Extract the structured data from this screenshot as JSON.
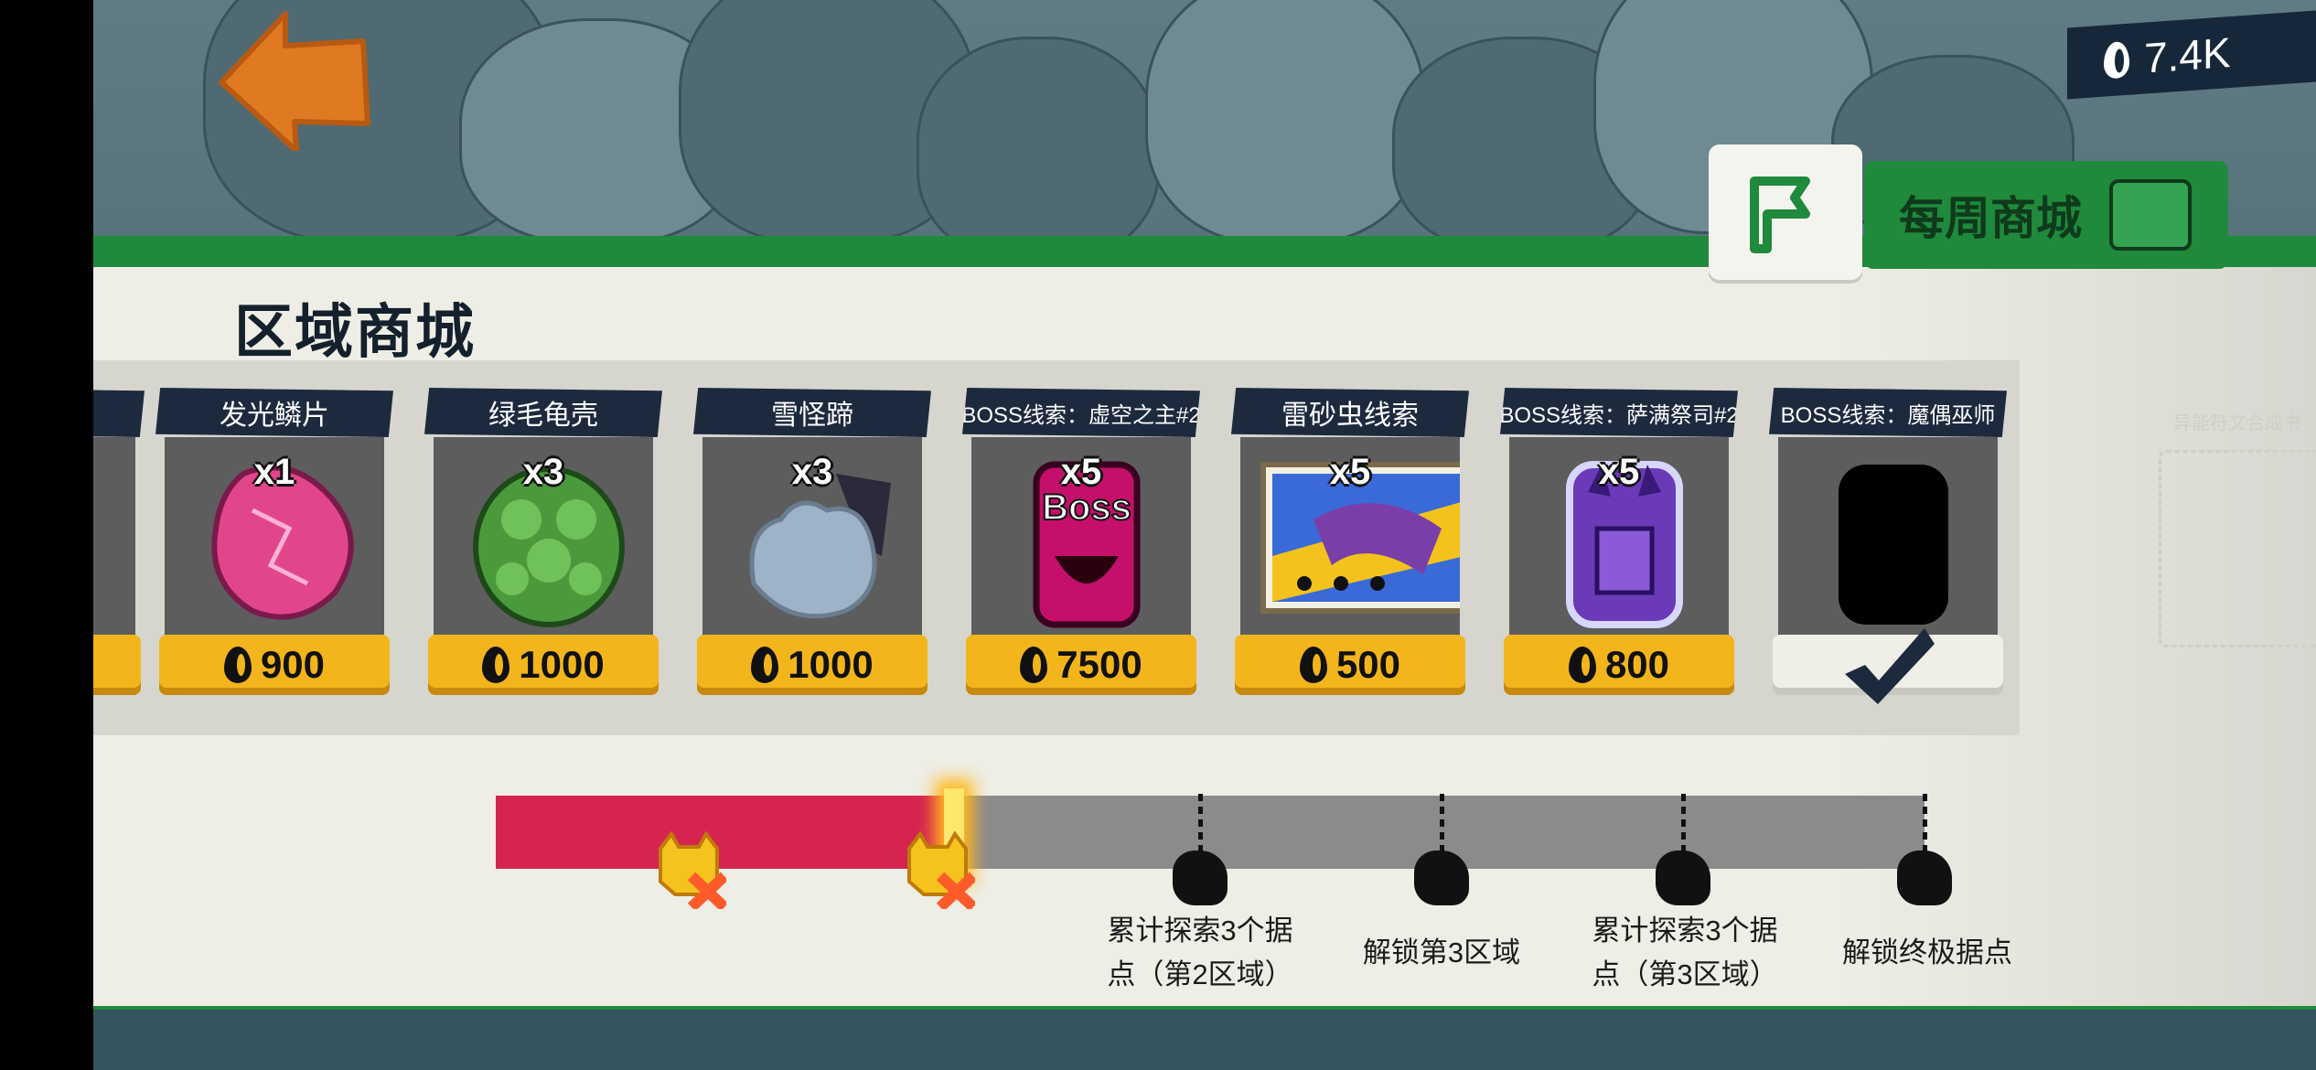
{
  "header": {
    "currency_amount": "7.4K",
    "tabs": [
      {
        "label": "",
        "icon": "flag-icon"
      },
      {
        "label": "每周商城",
        "icon": "chest-monster-icon"
      }
    ]
  },
  "shop": {
    "title": "区域商城",
    "items": [
      {
        "name": "发光鳞片",
        "qty": "x1",
        "price": "900",
        "icon": "glowing-scale-icon",
        "color": "#e2468a"
      },
      {
        "name": "绿毛龟壳",
        "qty": "x3",
        "price": "1000",
        "icon": "turtle-shell-icon",
        "color": "#4a9a3c"
      },
      {
        "name": "雪怪蹄",
        "qty": "x3",
        "price": "1000",
        "icon": "yeti-hoof-icon",
        "color": "#9fb3c8"
      },
      {
        "name": "BOSS线索：虚空之主#2",
        "qty": "x5",
        "price": "7500",
        "icon": "boss-card-icon",
        "color": "#c4106a",
        "boss_text": "Boss"
      },
      {
        "name": "雷砂虫线索",
        "qty": "x5",
        "price": "500",
        "icon": "sandworm-map-icon",
        "color": "#7a3ea8"
      },
      {
        "name": "BOSS线索：萨满祭司#2",
        "qty": "x5",
        "price": "800",
        "icon": "shaman-card-icon",
        "color": "#6a3ab8"
      },
      {
        "name": "BOSS线索：魔偶巫师",
        "qty": "",
        "price": "",
        "icon": "locked-silhouette-icon",
        "color": "#000000",
        "owned": true
      }
    ]
  },
  "progress": {
    "fill_fraction": 0.32,
    "milestones": [
      {
        "line1": "累计探索3个据",
        "line2": "点（第2区域）"
      },
      {
        "line1": "解锁第3区域",
        "line2": ""
      },
      {
        "line1": "累计探索3个据",
        "line2": "点（第3区域）"
      },
      {
        "line1": "解锁终极据点",
        "line2": ""
      }
    ]
  },
  "side_hint": {
    "text": "异能符文合成书"
  }
}
